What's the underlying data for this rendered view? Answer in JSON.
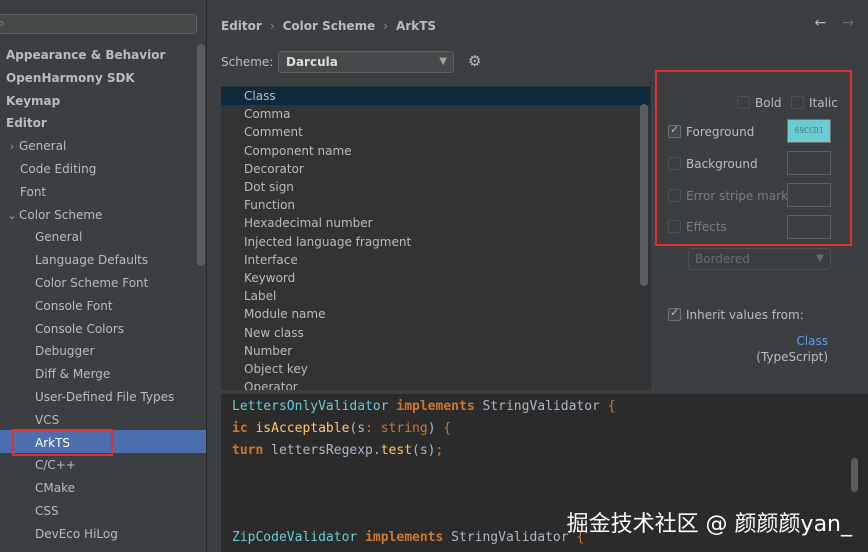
{
  "search": {
    "placeholder": ""
  },
  "tree": {
    "items": [
      {
        "label": "Appearance & Behavior",
        "bold": true
      },
      {
        "label": "OpenHarmony SDK",
        "bold": true
      },
      {
        "label": "Keymap",
        "bold": true
      },
      {
        "label": "Editor",
        "bold": true
      },
      {
        "label": "General",
        "chevron": "›"
      },
      {
        "label": "Code Editing"
      },
      {
        "label": "Font"
      },
      {
        "label": "Color Scheme",
        "chevron": "⌄"
      },
      {
        "label": "General"
      },
      {
        "label": "Language Defaults"
      },
      {
        "label": "Color Scheme Font"
      },
      {
        "label": "Console Font"
      },
      {
        "label": "Console Colors"
      },
      {
        "label": "Debugger"
      },
      {
        "label": "Diff & Merge"
      },
      {
        "label": "User-Defined File Types"
      },
      {
        "label": "VCS"
      },
      {
        "label": "ArkTS",
        "selected": true
      },
      {
        "label": "C/C++"
      },
      {
        "label": "CMake"
      },
      {
        "label": "CSS"
      },
      {
        "label": "DevEco HiLog"
      }
    ]
  },
  "breadcrumb": {
    "part1": "Editor",
    "sep": "›",
    "part2": "Color Scheme",
    "part3": "ArkTS"
  },
  "nav": {
    "back": "←",
    "forward": "→"
  },
  "scheme": {
    "label": "Scheme:",
    "value": "Darcula",
    "arrow": "▼",
    "gear": "⚙"
  },
  "elements": {
    "items": [
      "Class",
      "Comma",
      "Comment",
      "Component name",
      "Decorator",
      "Dot sign",
      "Function",
      "Hexadecimal number",
      "Injected language fragment",
      "Interface",
      "Keyword",
      "Label",
      "Module name",
      "New class",
      "Number",
      "Object key",
      "Operator"
    ],
    "selected": "Class"
  },
  "attributes": {
    "bold": "Bold",
    "italic": "Italic",
    "foreground": {
      "label": "Foreground",
      "checked": true,
      "value": "69CCD1",
      "color": "#69ccd1"
    },
    "background": {
      "label": "Background",
      "checked": false
    },
    "error_stripe": {
      "label": "Error stripe mark",
      "checked": false
    },
    "effects": {
      "label": "Effects",
      "checked": false
    },
    "effects_type": "Bordered",
    "inherit": {
      "label": "Inherit values from:",
      "checked": true,
      "link": "Class",
      "source": "(TypeScript)"
    }
  },
  "preview": {
    "line1": {
      "cls": "LettersOnlyValidator",
      "kw": "implements",
      "iface": "StringValidator",
      "brace": "{"
    },
    "line2": {
      "kw": "ic",
      "fn": "isAcceptable",
      "open": "(",
      "param": "s",
      "colon": ":",
      "type": "string",
      "close": ")",
      "brace": "{"
    },
    "line3": {
      "kw": "turn",
      "obj": "lettersRegexp",
      "dot": ".",
      "call": "test",
      "args": "(s)",
      "semi": ";"
    },
    "line4": {
      "cls": "ZipCodeValidator",
      "kw": "implements",
      "iface": "StringValidator",
      "brace": "{"
    }
  },
  "watermark": "掘金技术社区 @ 颜颜颜yan_",
  "colors": {
    "accent_selection": "#4b6eaf",
    "highlight_box": "#e03030",
    "foreground_swatch": "#69ccd1"
  }
}
